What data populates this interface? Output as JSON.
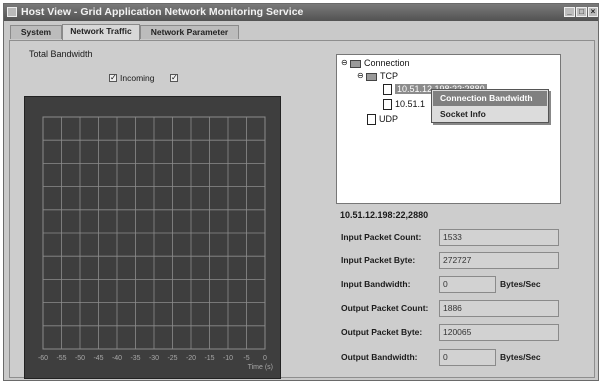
{
  "window": {
    "title": "Host View - Grid Application Network Monitoring Service",
    "controls": {
      "minimize": "_",
      "maximize": "□",
      "close": "×"
    }
  },
  "tabs": [
    {
      "label": "System",
      "active": false
    },
    {
      "label": "Network Traffic",
      "active": true
    },
    {
      "label": "Network Parameter",
      "active": false
    }
  ],
  "bandwidth": {
    "title": "Total Bandwidth",
    "incoming_label": "Incoming",
    "incoming_checked": true,
    "outgoing_checked": true
  },
  "chart_data": {
    "type": "line",
    "title": "",
    "x_ticks": [
      "-60",
      "-55",
      "-50",
      "-45",
      "-40",
      "-35",
      "-30",
      "-25",
      "-20",
      "-15",
      "-10",
      "-5",
      "0"
    ],
    "xlabel": "Time (s)",
    "series": [],
    "grid": true,
    "colors": {
      "background": "#3e3e3e",
      "grid": "#8c8c8c",
      "tick_text": "#a8a8a8"
    }
  },
  "tree": {
    "root": "Connection",
    "tcp": "TCP",
    "conn1": "10.51.12.198:22:2880",
    "conn2": "10.51.1",
    "udp": "UDP",
    "root_toggle": "⊖",
    "tcp_toggle": "⊖"
  },
  "context_menu": {
    "items": [
      {
        "label": "Connection Bandwidth",
        "highlighted": true
      },
      {
        "label": "Socket Info",
        "highlighted": false
      }
    ]
  },
  "details": {
    "connection": "10.51.12.198:22,2880",
    "fields": [
      {
        "label": "Input Packet Count:",
        "value": "1533",
        "unit": ""
      },
      {
        "label": "Input Packet Byte:",
        "value": "272727",
        "unit": ""
      },
      {
        "label": "Input Bandwidth:",
        "value": "0",
        "unit": "Bytes/Sec"
      },
      {
        "label": "Output Packet Count:",
        "value": "1886",
        "unit": ""
      },
      {
        "label": "Output Packet Byte:",
        "value": "120065",
        "unit": ""
      },
      {
        "label": "Output Bandwidth:",
        "value": "0",
        "unit": "Bytes/Sec"
      }
    ]
  }
}
